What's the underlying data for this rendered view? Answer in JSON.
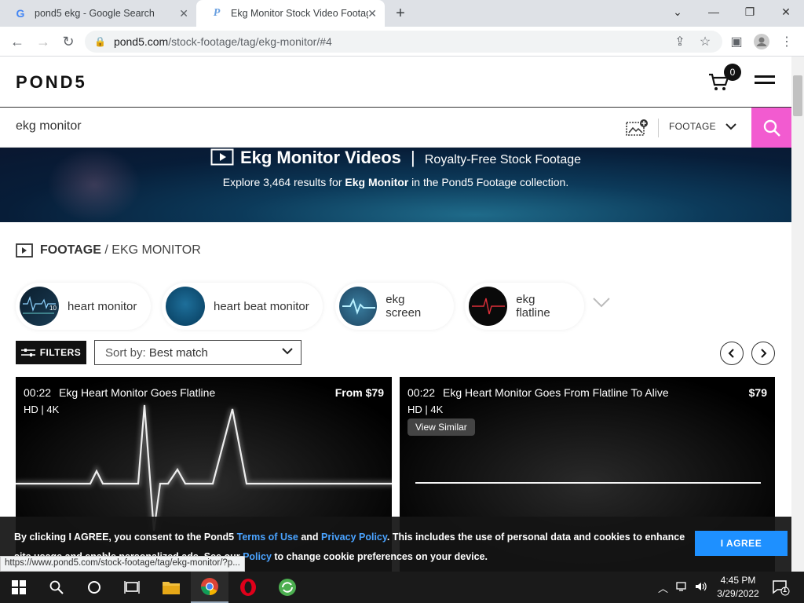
{
  "browser": {
    "tabs": [
      {
        "title": "pond5 ekg - Google Search",
        "favicon": "G"
      },
      {
        "title": "Ekg Monitor Stock Video Footage",
        "favicon": "P"
      }
    ],
    "url_host": "pond5.com",
    "url_path": "/stock-footage/tag/ekg-monitor/#4",
    "status_url": "https://www.pond5.com/stock-footage/tag/ekg-monitor/?p..."
  },
  "site": {
    "logo": "POND5",
    "cart_count": "0"
  },
  "search": {
    "query": "ekg monitor",
    "media_type": "FOOTAGE"
  },
  "banner": {
    "title": "Ekg Monitor Videos",
    "separator": "|",
    "subtitle": "Royalty-Free Stock Footage",
    "desc_prefix": "Explore 3,464 results for ",
    "desc_term": "Ekg Monitor",
    "desc_suffix": " in the Pond5 Footage collection."
  },
  "breadcrumb": {
    "root": "FOOTAGE",
    "sep": " / ",
    "current": "EKG MONITOR"
  },
  "related": [
    {
      "label": "heart monitor"
    },
    {
      "label": "heart beat monitor"
    },
    {
      "label": "ekg screen"
    },
    {
      "label": "ekg flatline"
    }
  ],
  "toolbar": {
    "filters": "FILTERS",
    "sort_prefix": "Sort by: ",
    "sort_value": "Best match"
  },
  "results": [
    {
      "duration": "00:22",
      "title": "Ekg Heart Monitor Goes Flatline",
      "quality": "HD | 4K",
      "price": "From $79"
    },
    {
      "duration": "00:22",
      "title": "Ekg Heart Monitor Goes From Flatline To Alive",
      "quality": "HD | 4K",
      "price": "$79",
      "view_similar": "View Similar"
    }
  ],
  "cookie": {
    "t1": "By clicking I AGREE, you consent to the Pond5 ",
    "terms": "Terms of Use",
    "t2": " and ",
    "privacy": "Privacy Policy",
    "t3": ". This includes the use of personal data and cookies to enhance site usage and enable personalized ads. See our ",
    "policy": "Policy",
    "t4": " to change cookie preferences on your device.",
    "agree": "I AGREE"
  },
  "taskbar": {
    "time": "4:45 PM",
    "date": "3/29/2022",
    "notifications": "1"
  },
  "colors": {
    "accent_pink": "#f25bd0",
    "agree_blue": "#1e90ff",
    "link_blue": "#4aa3ff"
  }
}
